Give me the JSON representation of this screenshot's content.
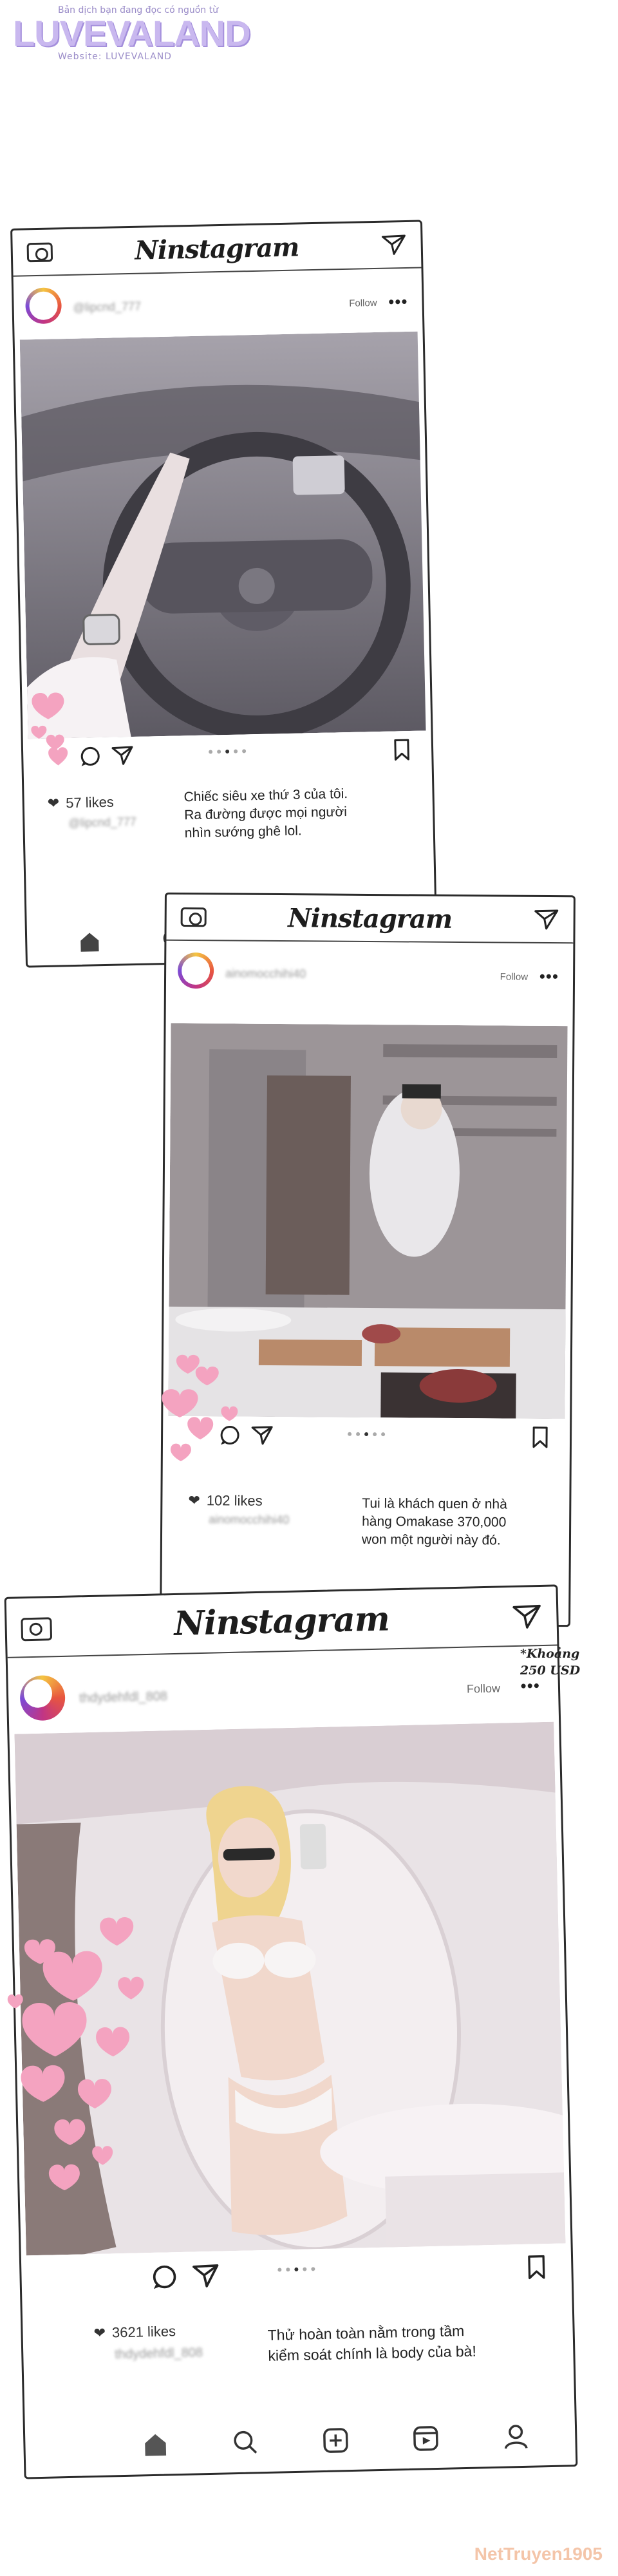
{
  "watermark": {
    "tagline": "Bản dịch bạn đang đọc có nguồn từ",
    "logo": "LUVEVALAND",
    "website": "Website: LUVEVALAND"
  },
  "app_name": "Ninstagram",
  "posts": [
    {
      "follow": "Follow",
      "more": "•••",
      "likes": "57 likes",
      "caption": [
        "Chiếc siêu xe thứ 3 của tôi.",
        "Ra đường được mọi người",
        "nhìn sướng ghê lol."
      ],
      "username": "@lipcnd_777"
    },
    {
      "follow": "Follow",
      "more": "•••",
      "likes": "102 likes",
      "caption": [
        "Tui là khách quen ở nhà",
        "hàng Omakase 370,000",
        "won một người này đó."
      ],
      "username": "ainomocchihi40"
    },
    {
      "follow": "Follow",
      "more": "•••",
      "likes": "3621 likes",
      "caption": [
        "Thử hoàn toàn nằm trong tầm",
        "kiểm soát chính là body của bà!"
      ],
      "username": "thdydehfdl_808"
    }
  ],
  "note": [
    "*Khoảng",
    "250 USD"
  ],
  "footer": "NetTruyen1905",
  "colors": {
    "frame": "#2b2b2b",
    "heart_pink": "#f4a3c0",
    "watermark": "#c9b8ef"
  },
  "icons": [
    "camera-icon",
    "send-icon",
    "heart-icon",
    "comment-icon",
    "share-icon",
    "bookmark-icon",
    "home-icon",
    "search-icon",
    "add-icon",
    "reels-icon",
    "profile-icon"
  ]
}
